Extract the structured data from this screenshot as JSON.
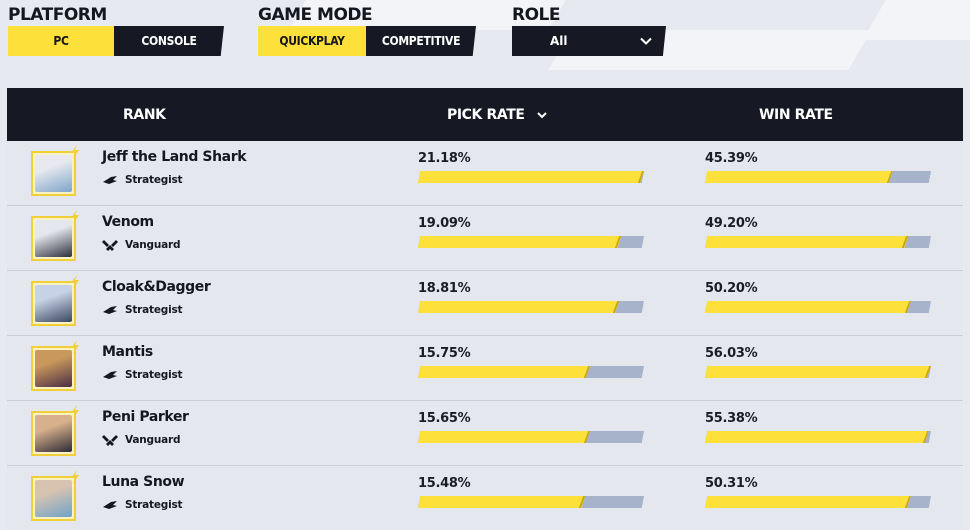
{
  "filters": {
    "platform": {
      "label": "PLATFORM",
      "options": [
        "PC",
        "CONSOLE"
      ],
      "selected": "PC"
    },
    "game_mode": {
      "label": "GAME MODE",
      "options": [
        "QUICKPLAY",
        "COMPETITIVE"
      ],
      "selected": "QUICKPLAY"
    },
    "role": {
      "label": "ROLE",
      "value": "All"
    }
  },
  "table": {
    "headers": {
      "rank": "RANK",
      "pick_rate": "PICK RATE",
      "win_rate": "WIN RATE"
    },
    "rows": [
      {
        "name": "Jeff the Land Shark",
        "role": "Strategist",
        "role_icon": "strategist-icon",
        "pick_rate": "21.18%",
        "pick_fraction": 1.0,
        "win_rate": "45.39%",
        "win_fraction": 0.83,
        "avatar_colors": [
          "#7ea4c9",
          "#e7e9ef"
        ]
      },
      {
        "name": "Venom",
        "role": "Vanguard",
        "role_icon": "vanguard-icon",
        "pick_rate": "19.09%",
        "pick_fraction": 0.9,
        "win_rate": "49.20%",
        "win_fraction": 0.9,
        "avatar_colors": [
          "#2c2f3c",
          "#e5e7ee"
        ]
      },
      {
        "name": "Cloak&Dagger",
        "role": "Strategist",
        "role_icon": "strategist-icon",
        "pick_rate": "18.81%",
        "pick_fraction": 0.89,
        "win_rate": "50.20%",
        "win_fraction": 0.91,
        "avatar_colors": [
          "#3b4660",
          "#c7d2e6"
        ]
      },
      {
        "name": "Mantis",
        "role": "Strategist",
        "role_icon": "strategist-icon",
        "pick_rate": "15.75%",
        "pick_fraction": 0.76,
        "win_rate": "56.03%",
        "win_fraction": 1.0,
        "avatar_colors": [
          "#4b2d44",
          "#c9995c"
        ]
      },
      {
        "name": "Peni Parker",
        "role": "Vanguard",
        "role_icon": "vanguard-icon",
        "pick_rate": "15.65%",
        "pick_fraction": 0.76,
        "win_rate": "55.38%",
        "win_fraction": 0.99,
        "avatar_colors": [
          "#2d2a36",
          "#d7b08c"
        ]
      },
      {
        "name": "Luna Snow",
        "role": "Strategist",
        "role_icon": "strategist-icon",
        "pick_rate": "15.48%",
        "pick_fraction": 0.74,
        "win_rate": "50.31%",
        "win_fraction": 0.91,
        "avatar_colors": [
          "#6ea3c7",
          "#d8c3b1"
        ]
      }
    ]
  },
  "colors": {
    "accent": "#fde03a",
    "dark": "#161923",
    "bar_track": "#a7b2cb",
    "row_bg": "#e4e8ee"
  }
}
